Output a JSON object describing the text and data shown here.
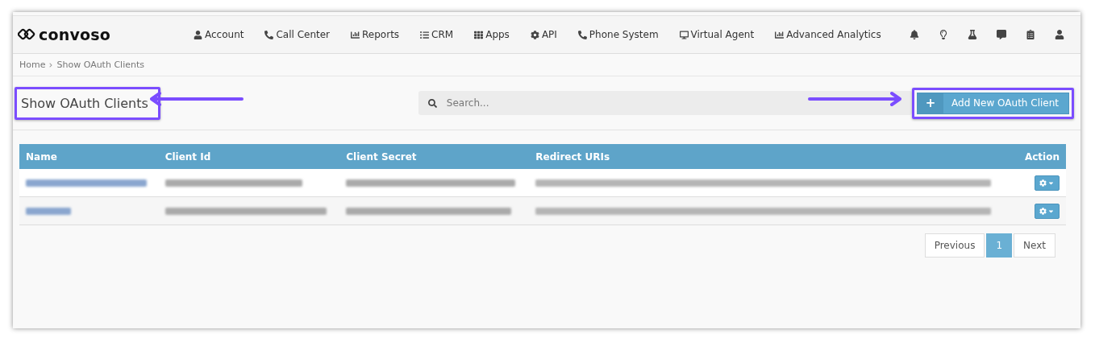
{
  "brand": {
    "name": "convoso"
  },
  "nav": [
    {
      "label": "Account"
    },
    {
      "label": "Call Center"
    },
    {
      "label": "Reports"
    },
    {
      "label": "CRM"
    },
    {
      "label": "Apps"
    },
    {
      "label": "API"
    },
    {
      "label": "Phone System"
    },
    {
      "label": "Virtual Agent"
    },
    {
      "label": "Advanced Analytics"
    }
  ],
  "breadcrumb": [
    "Home",
    "Show OAuth Clients"
  ],
  "page_title": "Show OAuth Clients",
  "search": {
    "placeholder": "Search..."
  },
  "add_button": {
    "icon": "+",
    "label": "Add New OAuth Client"
  },
  "table": {
    "columns": [
      "Name",
      "Client Id",
      "Client Secret",
      "Redirect URIs",
      "Action"
    ],
    "rows": [
      {
        "kind": "blurred"
      },
      {
        "kind": "blurred"
      }
    ]
  },
  "pagination": [
    {
      "label": "Previous",
      "selected": false
    },
    {
      "label": "1",
      "selected": true
    },
    {
      "label": "Next",
      "selected": false
    }
  ]
}
